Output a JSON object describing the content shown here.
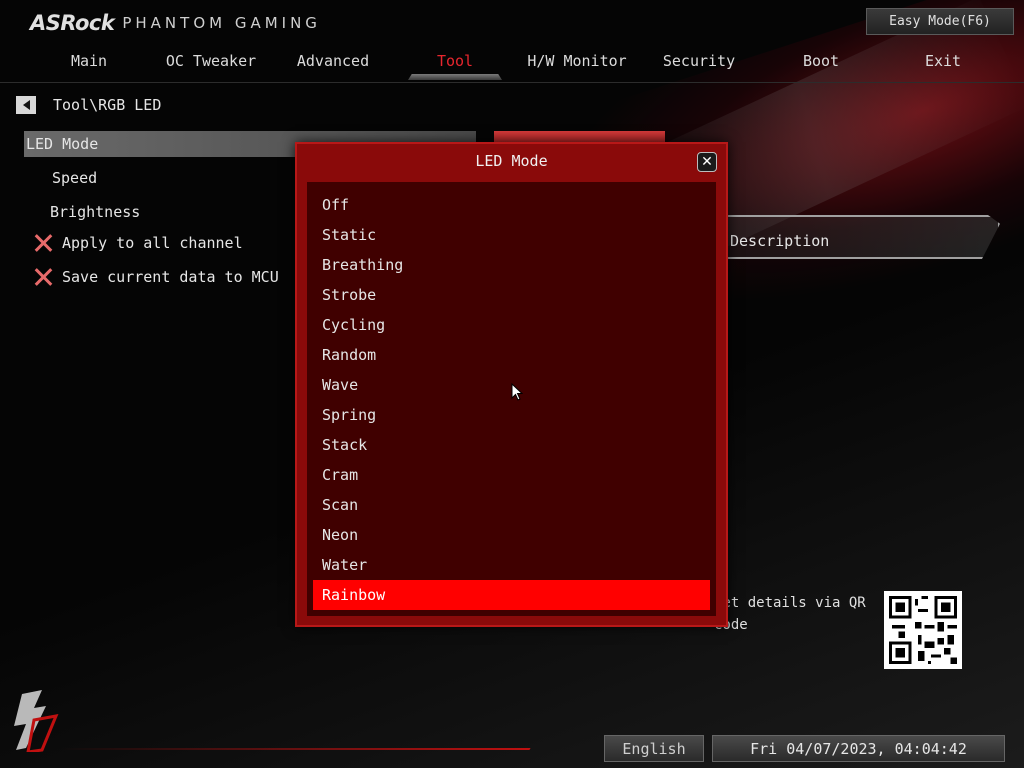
{
  "brand": {
    "logo_text": "ASRock",
    "sub_text": "PHANTOM GAMING"
  },
  "easy_mode_label": "Easy Mode(F6)",
  "nav": {
    "tabs": [
      {
        "label": "Main"
      },
      {
        "label": "OC Tweaker"
      },
      {
        "label": "Advanced"
      },
      {
        "label": "Tool"
      },
      {
        "label": "H/W Monitor"
      },
      {
        "label": "Security"
      },
      {
        "label": "Boot"
      },
      {
        "label": "Exit"
      }
    ],
    "active": "Tool"
  },
  "breadcrumb": "Tool\\RGB LED",
  "menu": {
    "items": [
      {
        "label": "LED Mode"
      },
      {
        "label": "Speed"
      },
      {
        "label": "Brightness"
      },
      {
        "label": "Apply to all channel"
      },
      {
        "label": "Save current data to MCU"
      }
    ]
  },
  "description": {
    "title": "Description",
    "qr_text": "Get details via QR code"
  },
  "modal": {
    "title": "LED Mode",
    "close_icon": "close-icon",
    "options": [
      {
        "label": "Off"
      },
      {
        "label": "Static"
      },
      {
        "label": "Breathing"
      },
      {
        "label": "Strobe"
      },
      {
        "label": "Cycling"
      },
      {
        "label": "Random"
      },
      {
        "label": "Wave"
      },
      {
        "label": "Spring"
      },
      {
        "label": "Stack"
      },
      {
        "label": "Cram"
      },
      {
        "label": "Scan"
      },
      {
        "label": "Neon"
      },
      {
        "label": "Water"
      },
      {
        "label": "Rainbow"
      }
    ],
    "selected": "Rainbow"
  },
  "footer": {
    "language": "English",
    "datetime": "Fri 04/07/2023, 04:04:42"
  },
  "colors": {
    "accent": "#ff0000",
    "modal_bg": "#8a0a0a",
    "list_bg": "#400000",
    "active_tab": "#e8262e"
  }
}
